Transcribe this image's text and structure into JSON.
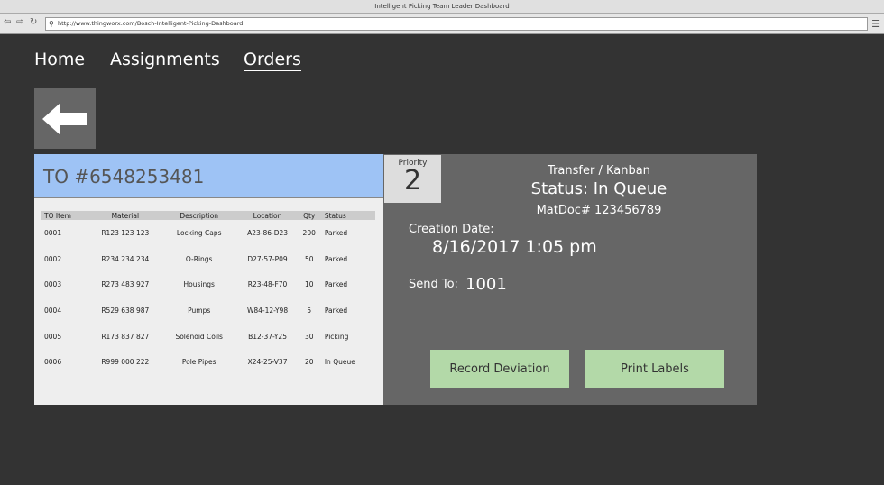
{
  "window": {
    "title": "Intelligent Picking Team Leader Dashboard",
    "url": "http://www.thingworx.com/Bosch-Intelligent-Picking-Dashboard"
  },
  "nav": {
    "home": "Home",
    "assignments": "Assignments",
    "orders": "Orders"
  },
  "order": {
    "title": "TO #6548253481",
    "columns": [
      "TO Item",
      "Material",
      "Description",
      "Location",
      "Qty",
      "Status"
    ],
    "rows": [
      [
        "0001",
        "R123 123 123",
        "Locking Caps",
        "A23-86-D23",
        "200",
        "Parked"
      ],
      [
        "0002",
        "R234 234 234",
        "O-Rings",
        "D27-57-P09",
        "50",
        "Parked"
      ],
      [
        "0003",
        "R273 483 927",
        "Housings",
        "R23-48-F70",
        "10",
        "Parked"
      ],
      [
        "0004",
        "R529 638 987",
        "Pumps",
        "W84-12-Y98",
        "5",
        "Parked"
      ],
      [
        "0005",
        "R173 837 827",
        "Solenoid Coils",
        "B12-37-Y25",
        "30",
        "Picking"
      ],
      [
        "0006",
        "R999 000 222",
        "Pole Pipes",
        "X24-25-V37",
        "20",
        "In Queue"
      ]
    ]
  },
  "detail": {
    "priority_label": "Priority",
    "priority": "2",
    "type": "Transfer / Kanban",
    "status": "Status: In Queue",
    "matdoc": "MatDoc# 123456789",
    "creation_label": "Creation Date:",
    "creation_date": "8/16/2017 1:05 pm",
    "send_label": "Send To:",
    "send_to": "1001",
    "record_deviation": "Record Deviation",
    "print_labels": "Print Labels"
  }
}
